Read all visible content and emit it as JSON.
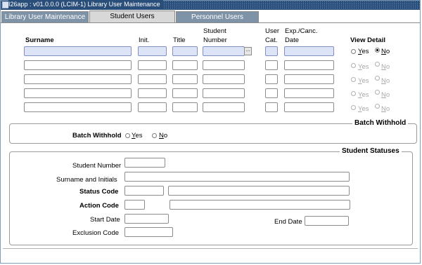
{
  "window": {
    "title": "I26app : v01.0.0.0 (LCIM-1) Library User Maintenance"
  },
  "tabs": [
    {
      "label": "Library User Maintenance"
    },
    {
      "label": "Student Users"
    },
    {
      "label": "Personnel Users"
    }
  ],
  "grid": {
    "headers": {
      "surname": "Surname",
      "init": "Init.",
      "title": "Title",
      "student_number_1": "Student",
      "student_number_2": "Number",
      "user_cat_1": "User",
      "user_cat_2": "Cat.",
      "exp_date_1": "Exp./Canc.",
      "exp_date_2": "Date",
      "view_detail": "View Detail"
    },
    "rows": [
      {
        "surname": "",
        "init": "",
        "title": "",
        "student_number": "",
        "user_cat": "",
        "exp_date": "",
        "view_detail": "No",
        "enabled": true
      },
      {
        "surname": "",
        "init": "",
        "title": "",
        "student_number": "",
        "user_cat": "",
        "exp_date": "",
        "view_detail": "No",
        "enabled": false
      },
      {
        "surname": "",
        "init": "",
        "title": "",
        "student_number": "",
        "user_cat": "",
        "exp_date": "",
        "view_detail": "No",
        "enabled": false
      },
      {
        "surname": "",
        "init": "",
        "title": "",
        "student_number": "",
        "user_cat": "",
        "exp_date": "",
        "view_detail": "No",
        "enabled": false
      },
      {
        "surname": "",
        "init": "",
        "title": "",
        "student_number": "",
        "user_cat": "",
        "exp_date": "",
        "view_detail": "No",
        "enabled": false
      }
    ],
    "radio_yes_prefix": "",
    "radio_yes_accel": "Y",
    "radio_yes_rest": "es",
    "radio_no_accel": "N",
    "radio_no_rest": "o",
    "lov_button": "..."
  },
  "batch_withhold": {
    "group_title": "Batch Withhold",
    "label": "Batch Withhold",
    "yes_accel": "Y",
    "yes_rest": "es",
    "no_accel": "N",
    "no_rest": "o"
  },
  "student_statuses": {
    "group_title": "Student Statuses",
    "student_number_label": "Student Number",
    "surname_initials_label": "Surname and Initials",
    "status_code_label": "Status Code",
    "action_code_label": "Action Code",
    "start_date_label": "Start Date",
    "end_date_label": "End Date",
    "exclusion_code_label": "Exclusion Code",
    "student_number": "",
    "surname_initials": "",
    "status_code": "",
    "status_desc": "",
    "action_code": "",
    "action_desc": "",
    "start_date": "",
    "end_date": "",
    "exclusion_code": ""
  },
  "colors": {
    "title_bar": "#2a4e7a",
    "active_tab": "#d8d8d8",
    "inactive_tab": "#7f93a8",
    "current_record": "#dde4f8"
  }
}
